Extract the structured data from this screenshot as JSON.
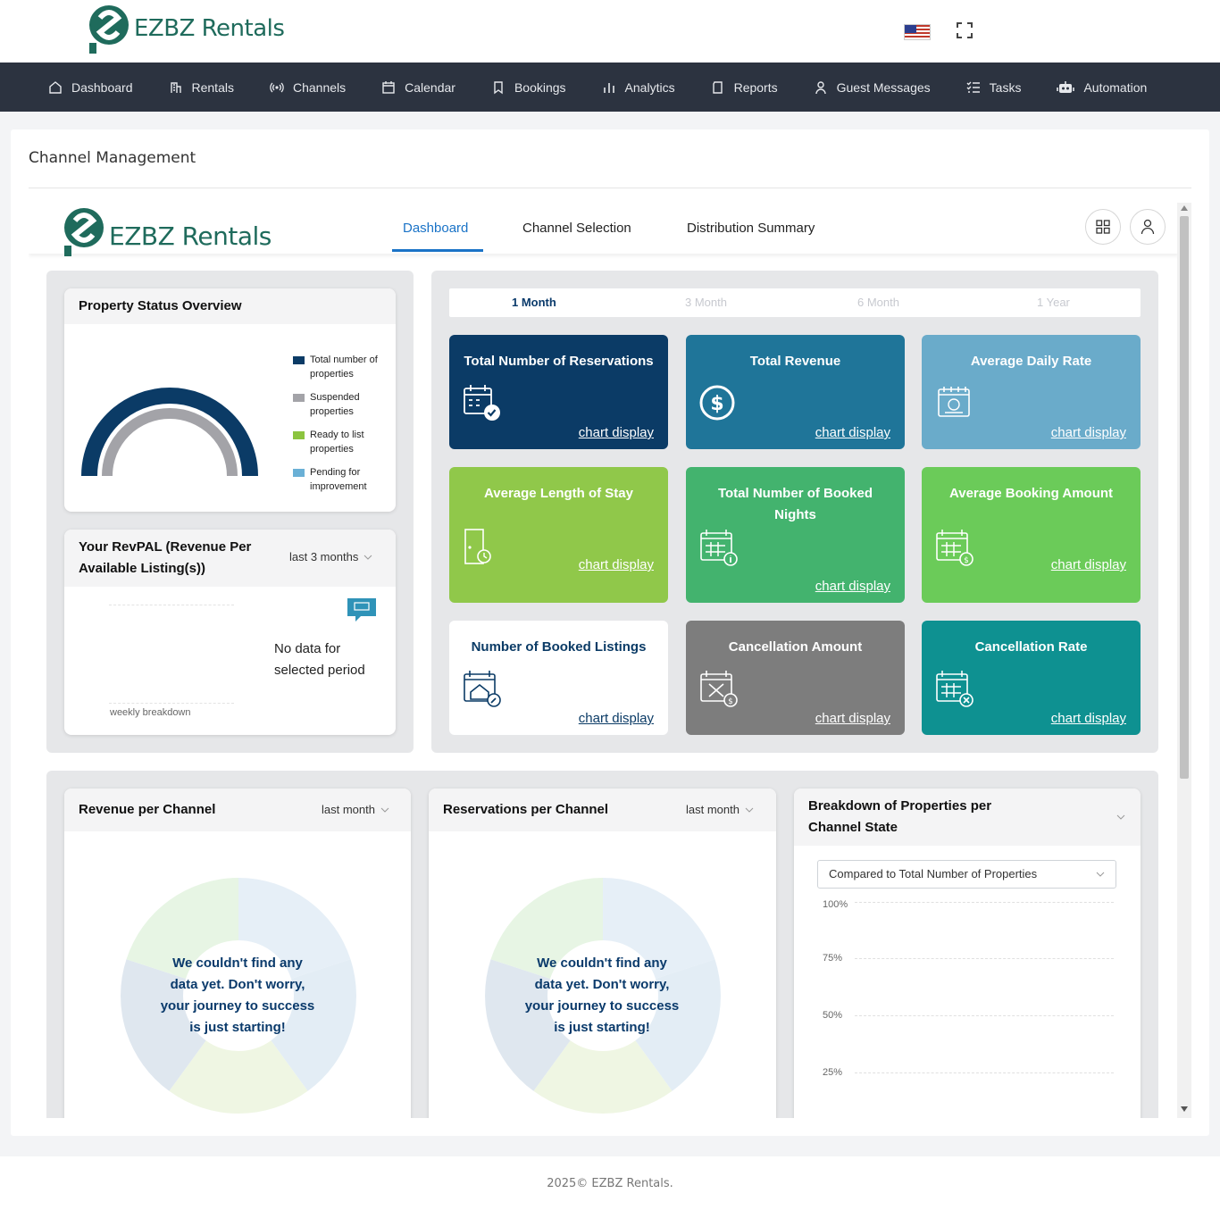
{
  "brand": {
    "name": "EZBZ Rentals"
  },
  "nav": {
    "items": [
      {
        "label": "Dashboard",
        "icon": "home-icon"
      },
      {
        "label": "Rentals",
        "icon": "building-icon"
      },
      {
        "label": "Channels",
        "icon": "broadcast-icon"
      },
      {
        "label": "Calendar",
        "icon": "calendar-icon"
      },
      {
        "label": "Bookings",
        "icon": "bookmark-icon"
      },
      {
        "label": "Analytics",
        "icon": "bar-chart-icon"
      },
      {
        "label": "Reports",
        "icon": "report-icon"
      },
      {
        "label": "Guest Messages",
        "icon": "user-icon"
      },
      {
        "label": "Tasks",
        "icon": "task-list-icon"
      },
      {
        "label": "Automation",
        "icon": "robot-icon"
      }
    ]
  },
  "page": {
    "title": "Channel Management"
  },
  "tabs": [
    {
      "label": "Dashboard",
      "active": true
    },
    {
      "label": "Channel Selection",
      "active": false
    },
    {
      "label": "Distribution Summary",
      "active": false
    }
  ],
  "property_status": {
    "title": "Property Status Overview",
    "legend": [
      {
        "label": "Total number of properties",
        "color": "#0b3b66"
      },
      {
        "label": "Suspended properties",
        "color": "#a3a3a8"
      },
      {
        "label": "Ready to list properties",
        "color": "#8cc43f"
      },
      {
        "label": "Pending for improvement",
        "color": "#6ab0d6"
      }
    ]
  },
  "revpal": {
    "title": "Your RevPAL (Revenue Per Available Listing(s))",
    "period": "last 3 months",
    "empty_message": "No data for selected period",
    "footnote": "weekly breakdown"
  },
  "periods": [
    {
      "label": "1 Month",
      "active": true
    },
    {
      "label": "3 Month",
      "active": false
    },
    {
      "label": "6 Month",
      "active": false
    },
    {
      "label": "1 Year",
      "active": false
    }
  ],
  "tiles": [
    {
      "title": "Total Number of Reservations",
      "link": "chart display",
      "color": "#0b3b66",
      "icon": "calendar-check-icon"
    },
    {
      "title": "Total Revenue",
      "link": "chart display",
      "color": "#1f7599",
      "icon": "dollar-circle-icon"
    },
    {
      "title": "Average Daily Rate",
      "link": "chart display",
      "color": "#6aabca",
      "icon": "calendar-dollar-icon"
    },
    {
      "title": "Average Length of Stay",
      "link": "chart display",
      "color": "#90c84a",
      "icon": "door-clock-icon"
    },
    {
      "title": "Total Number of Booked Nights",
      "link": "chart display",
      "color": "#43b36e",
      "icon": "calendar-info-icon"
    },
    {
      "title": "Average Booking Amount",
      "link": "chart display",
      "color": "#6bcb59",
      "icon": "calendar-coin-icon"
    },
    {
      "title": "Number of Booked Listings",
      "link": "chart display",
      "color": "#ffffff",
      "icon": "calendar-house-icon"
    },
    {
      "title": "Cancellation Amount",
      "link": "chart display",
      "color": "#7d7d7d",
      "icon": "calendar-cancel-dollar-icon"
    },
    {
      "title": "Cancellation Rate",
      "link": "chart display",
      "color": "#0e9191",
      "icon": "calendar-cancel-icon"
    }
  ],
  "revenue_channel": {
    "title": "Revenue per Channel",
    "period": "last month",
    "empty_message": "We couldn't find any data yet. Don't worry, your journey to success is just starting!"
  },
  "reservations_channel": {
    "title": "Reservations per Channel",
    "period": "last month",
    "empty_message": "We couldn't find any data yet. Don't worry, your journey to success is just starting!"
  },
  "breakdown": {
    "title": "Breakdown of Properties per Channel State",
    "select_value": "Compared to Total Number of Properties",
    "axis": [
      "100%",
      "75%",
      "50%",
      "25%"
    ]
  },
  "footer": {
    "text": "2025© EZBZ Rentals."
  }
}
